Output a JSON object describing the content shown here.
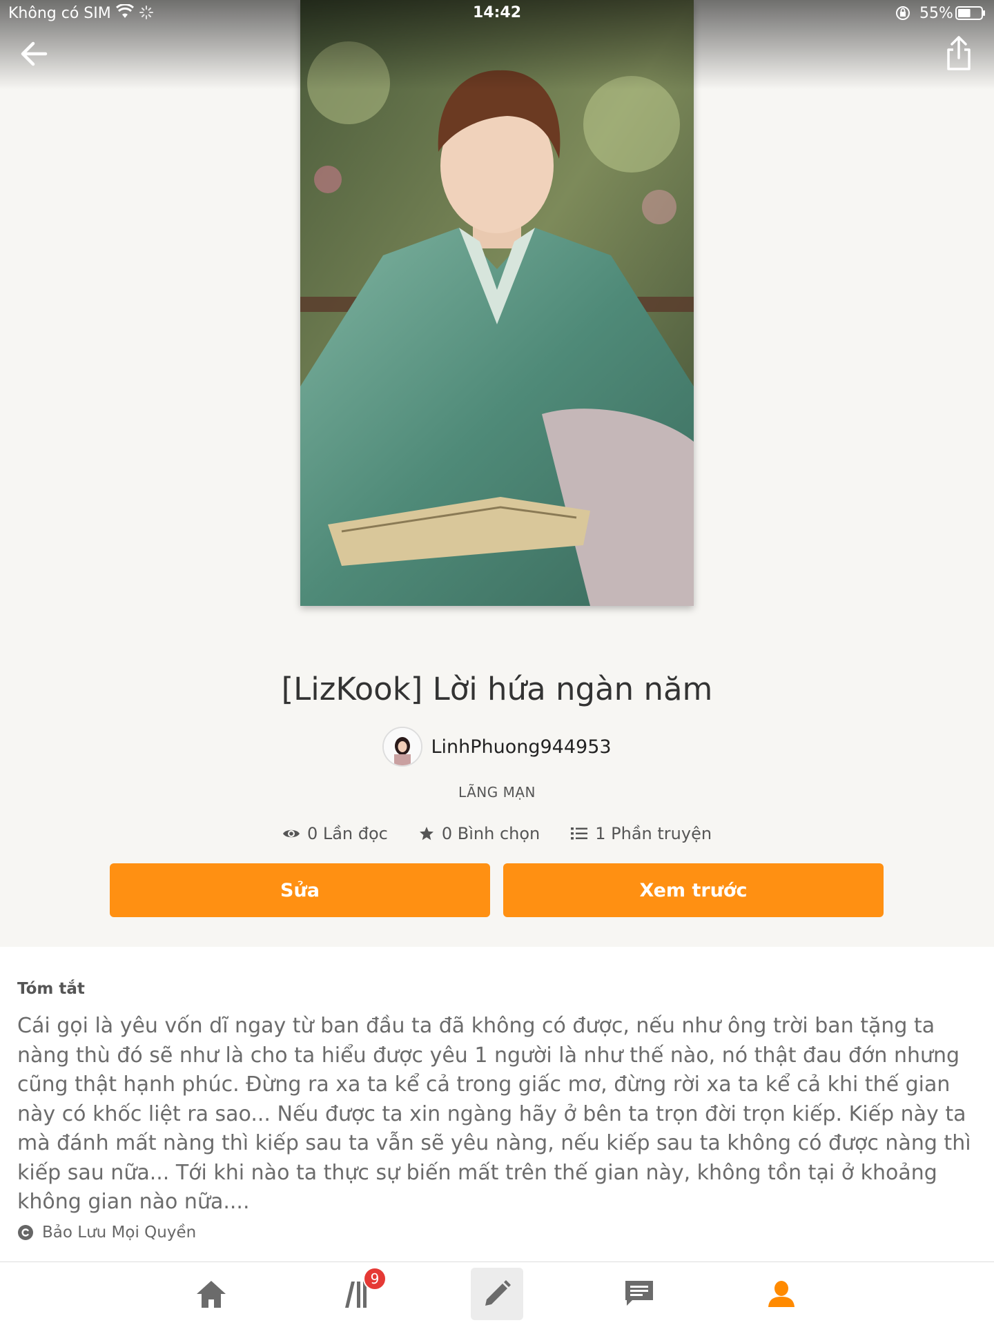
{
  "status_bar": {
    "carrier": "Không có SIM",
    "time": "14:42",
    "battery": "55%",
    "battery_level": 0.55
  },
  "nav": {
    "back_icon": "arrow-left-icon",
    "share_icon": "share-icon"
  },
  "story": {
    "title": "[LizKook] Lời hứa ngàn năm",
    "author": "LinhPhuong944953",
    "genre": "LÃNG MẠN",
    "stats": {
      "reads": "0 Lần đọc",
      "votes": "0 Bình chọn",
      "parts": "1 Phần truyện"
    }
  },
  "actions": {
    "edit": "Sửa",
    "preview": "Xem trước"
  },
  "summary": {
    "heading": "Tóm tắt",
    "text": "Cái gọi là yêu vốn dĩ ngay từ ban đầu ta đã không có được, nếu như ông trời ban tặng ta nàng thù đó sẽ như là cho ta hiểu được yêu 1 người là như thế nào, nó thật đau đớn nhưng cũng thật hạnh phúc. Đừng ra xa ta kể cả trong giấc mơ, đừng rời xa ta kể cả khi thế gian này có khốc liệt ra sao... Nếu được ta xin ngàng hãy ở bên ta trọn  đời trọn kiếp. Kiếp này ta mà đánh mất nàng thì kiếp sau ta vẫn sẽ yêu nàng, nếu kiếp sau ta không có được nàng thì kiếp sau nữa... Tới khi nào ta thực sự biến mất trên thế gian này, không tồn tại ở khoảng không gian nào nữa....",
    "copyright": "Bảo Lưu Mọi Quyền"
  },
  "tab_bar": {
    "library_badge": "9",
    "tabs": [
      "home-icon",
      "library-icon",
      "write-icon",
      "messages-icon",
      "profile-icon"
    ],
    "active_tab": "profile-icon"
  },
  "colors": {
    "accent": "#ff9012",
    "badge": "#e53935",
    "background_top": "#f7f6f3"
  }
}
